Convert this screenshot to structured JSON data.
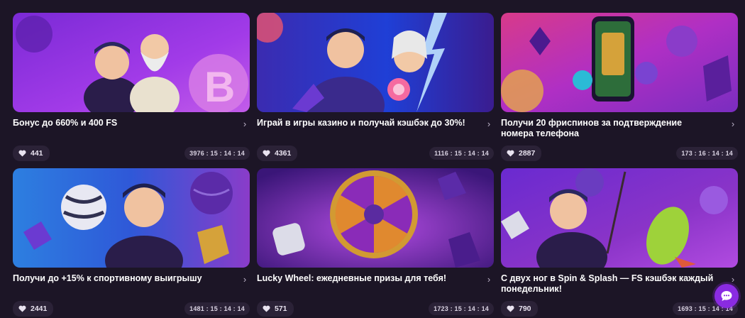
{
  "promos": [
    {
      "title": "Бонус до 660% и 400 FS",
      "likes": "441",
      "timer": "3976 : 15 : 14 : 14"
    },
    {
      "title": "Играй в игры казино и получай кэшбэк до 30%!",
      "likes": "4361",
      "timer": "1116 : 15 : 14 : 14"
    },
    {
      "title": "Получи 20 фриспинов за подтверждение номера телефона",
      "likes": "2887",
      "timer": "173 : 16 : 14 : 14"
    },
    {
      "title": "Получи до +15% к спортивному выигрышу",
      "likes": "2441",
      "timer": "1481 : 15 : 14 : 14"
    },
    {
      "title": "Lucky Wheel: ежедневные призы для тебя!",
      "likes": "571",
      "timer": "1723 : 15 : 14 : 14"
    },
    {
      "title": "С двух ног в Spin & Splash — FS кэшбэк каждый понедельник!",
      "likes": "790",
      "timer": "1693 : 15 : 14 : 14"
    }
  ],
  "icons": {
    "like": "heart-icon",
    "open": "chevron-right-icon",
    "chat": "chat-bubble-icon"
  },
  "colors": {
    "background": "#1c1526",
    "pill": "#2b2237",
    "accent": "#8a2be2"
  }
}
